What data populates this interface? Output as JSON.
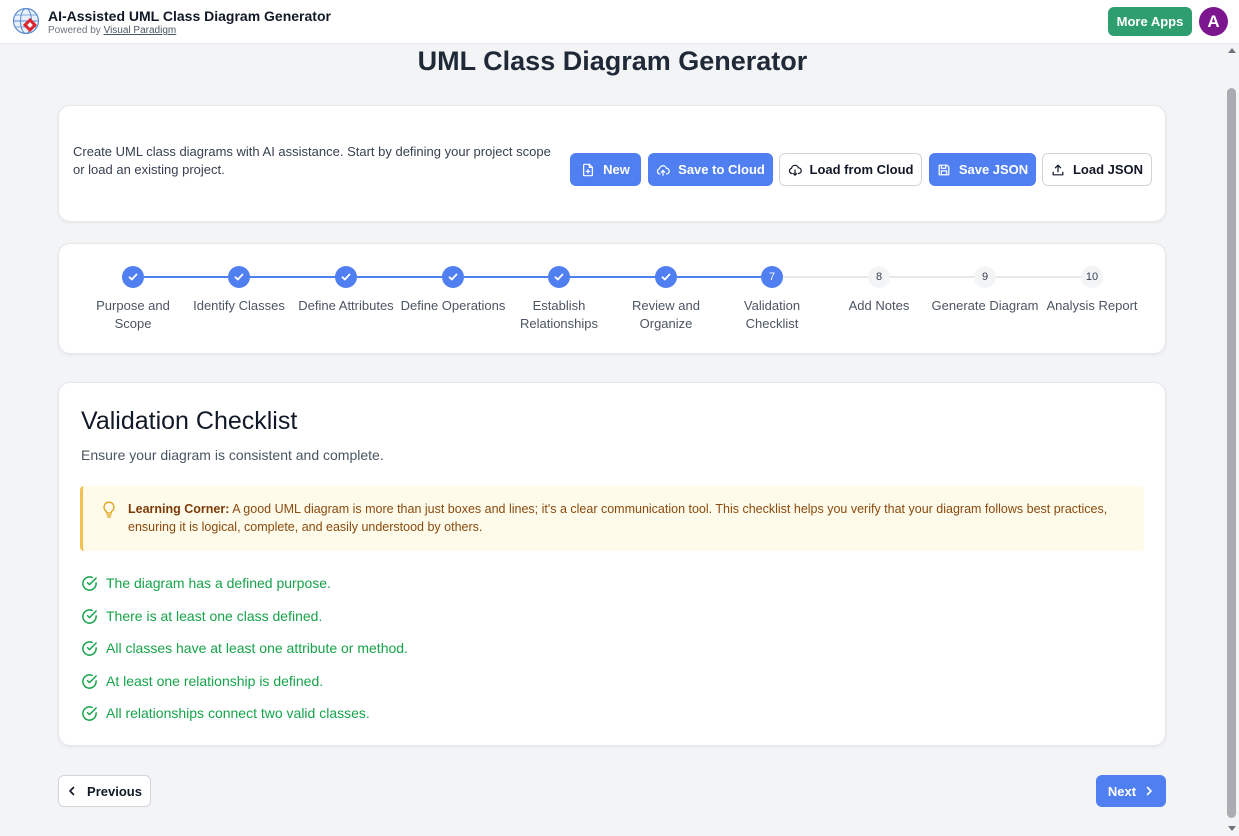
{
  "header": {
    "app_title": "AI-Assisted UML Class Diagram Generator",
    "powered_prefix": "Powered by",
    "powered_link": "Visual Paradigm",
    "more_apps_label": "More Apps",
    "avatar_initial": "A",
    "logo_icon": "globe-logo-icon"
  },
  "page": {
    "title": "UML Class Diagram Generator"
  },
  "toolbar": {
    "intro": "Create UML class diagrams with AI assistance. Start by defining your project scope or load an existing project.",
    "buttons": [
      {
        "label": "New",
        "icon": "file-plus-icon",
        "style": "primary"
      },
      {
        "label": "Save to Cloud",
        "icon": "cloud-upload-icon",
        "style": "primary"
      },
      {
        "label": "Load from Cloud",
        "icon": "cloud-download-icon",
        "style": "outline"
      },
      {
        "label": "Save JSON",
        "icon": "floppy-disk-icon",
        "style": "primary"
      },
      {
        "label": "Load JSON",
        "icon": "upload-icon",
        "style": "outline"
      }
    ]
  },
  "stepper": {
    "current_step": 7,
    "steps": [
      {
        "number": "1",
        "label_lines": [
          "Purpose and",
          "Scope"
        ],
        "status": "done"
      },
      {
        "number": "2",
        "label_lines": [
          "Identify Classes"
        ],
        "status": "done"
      },
      {
        "number": "3",
        "label_lines": [
          "Define Attributes"
        ],
        "status": "done"
      },
      {
        "number": "4",
        "label_lines": [
          "Define Operations"
        ],
        "status": "done"
      },
      {
        "number": "5",
        "label_lines": [
          "Establish",
          "Relationships"
        ],
        "status": "done"
      },
      {
        "number": "6",
        "label_lines": [
          "Review and",
          "Organize"
        ],
        "status": "done"
      },
      {
        "number": "7",
        "label_lines": [
          "Validation",
          "Checklist"
        ],
        "status": "current"
      },
      {
        "number": "8",
        "label_lines": [
          "Add Notes"
        ],
        "status": "todo"
      },
      {
        "number": "9",
        "label_lines": [
          "Generate Diagram"
        ],
        "status": "todo"
      },
      {
        "number": "10",
        "label_lines": [
          "Analysis Report"
        ],
        "status": "todo"
      }
    ]
  },
  "section": {
    "title": "Validation Checklist",
    "description": "Ensure your diagram is consistent and complete.",
    "learning_corner_title": "Learning Corner:",
    "learning_corner_text": " A good UML diagram is more than just boxes and lines; it's a clear communication tool. This checklist helps you verify that your diagram follows best practices, ensuring it is logical, complete, and easily understood by others.",
    "checklist": [
      "The diagram has a defined purpose.",
      "There is at least one class defined.",
      "All classes have at least one attribute or method.",
      "At least one relationship is defined.",
      "All relationships connect two valid classes."
    ]
  },
  "nav": {
    "previous_label": "Previous",
    "next_label": "Next"
  },
  "colors": {
    "primary": "#4f7ff0",
    "success": "#16a34a",
    "more_apps": "#2f9e6e",
    "avatar": "#7b168f",
    "learning_bg": "#fefbea",
    "learning_border": "#f2c14e"
  }
}
